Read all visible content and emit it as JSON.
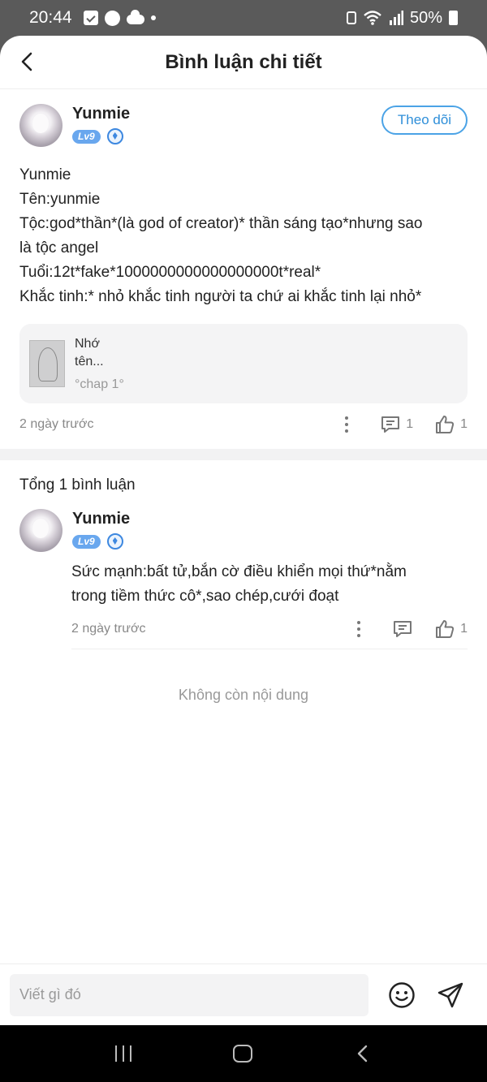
{
  "status_bar": {
    "time": "20:44",
    "battery": "50%"
  },
  "header": {
    "title": "Bình luận chi tiết"
  },
  "post": {
    "username": "Yunmie",
    "level": "Lv9",
    "follow_label": "Theo dõi",
    "lines": [
      "Yunmie",
      "Tên:yunmie",
      "Tộc:god*thần*(là god of creator)* thần sáng tạo*nhưng sao",
      "là tộc angel",
      "Tuổi:12t*fake*1000000000000000000t*real*",
      "Khắc tinh:* nhỏ khắc tinh người ta chứ ai khắc tinh lại nhỏ*"
    ],
    "ref": {
      "title_line1": "Nhớ",
      "title_line2": "tên...",
      "chapter": "°chap 1°"
    },
    "time": "2 ngày trước",
    "reply_count": "1",
    "like_count": "1"
  },
  "total_label": "Tổng 1 bình luận",
  "comment": {
    "username": "Yunmie",
    "level": "Lv9",
    "lines": [
      "Sức mạnh:bất tử,bắn cờ điều khiển mọi thứ*nằm",
      "trong tiềm thức cô*,sao chép,cưới đoạt"
    ],
    "time": "2 ngày trước",
    "like_count": "1"
  },
  "no_more_label": "Không còn nội dung",
  "input": {
    "placeholder": "Viết gì đó"
  }
}
